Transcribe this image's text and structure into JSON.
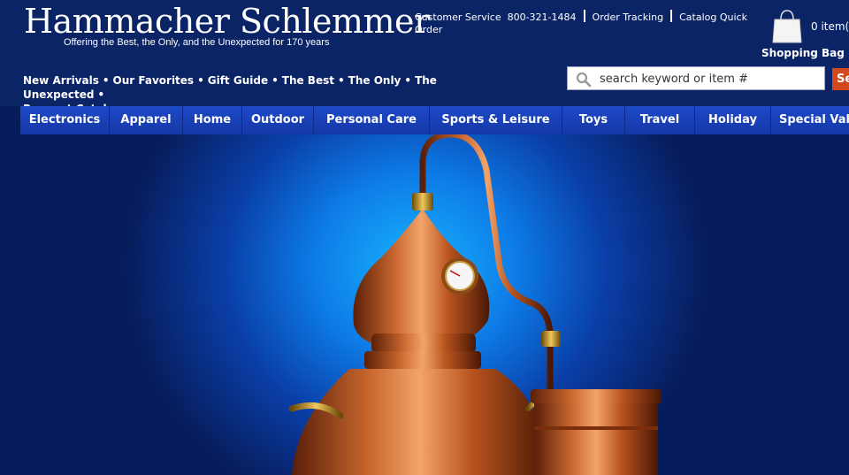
{
  "brand": {
    "name": "Hammacher Schlemmer",
    "tagline": "Offering the Best, the Only, and the Unexpected for 170 years"
  },
  "utility": {
    "customer_service": "Customer Service",
    "phone": "800-321-1484",
    "order_tracking": "Order Tracking",
    "catalog_quick_order": "Catalog Quick Order"
  },
  "bag": {
    "count": "0 item(",
    "label": "Shopping Bag",
    "icon": "shopping-bag-icon"
  },
  "quick_links": [
    "New Arrivals",
    "Our Favorites",
    "Gift Guide",
    "The Best",
    "The Only",
    "The Unexpected",
    "Request Catalog"
  ],
  "search": {
    "placeholder": "search  keyword or item #",
    "button": "Se"
  },
  "categories": [
    "Electronics",
    "Apparel",
    "Home",
    "Outdoor",
    "Personal Care",
    "Sports & Leisure",
    "Toys",
    "Travel",
    "Holiday",
    "Special Val"
  ],
  "colors": {
    "header_bg": "#0b2466",
    "nav_bg": "#1d4ac8",
    "search_button": "#d2491d",
    "copper": "#c8662e"
  }
}
